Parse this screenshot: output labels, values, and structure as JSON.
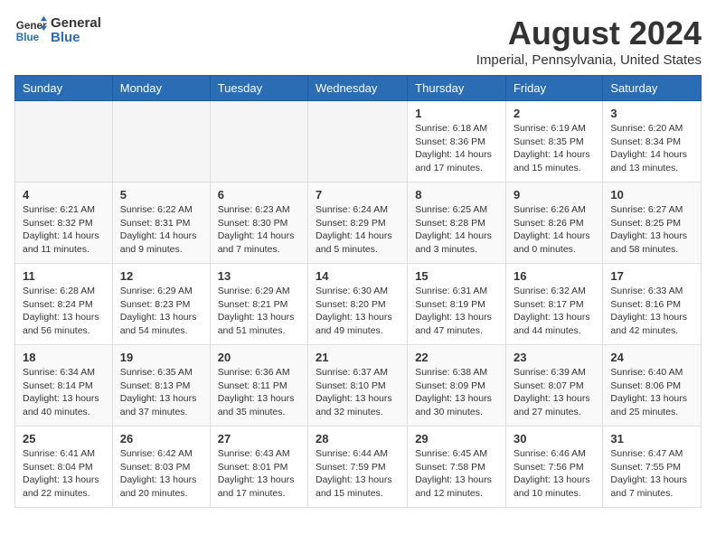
{
  "header": {
    "logo_line1": "General",
    "logo_line2": "Blue",
    "month": "August 2024",
    "location": "Imperial, Pennsylvania, United States"
  },
  "weekdays": [
    "Sunday",
    "Monday",
    "Tuesday",
    "Wednesday",
    "Thursday",
    "Friday",
    "Saturday"
  ],
  "weeks": [
    [
      {
        "day": "",
        "info": ""
      },
      {
        "day": "",
        "info": ""
      },
      {
        "day": "",
        "info": ""
      },
      {
        "day": "",
        "info": ""
      },
      {
        "day": "1",
        "info": "Sunrise: 6:18 AM\nSunset: 8:36 PM\nDaylight: 14 hours\nand 17 minutes."
      },
      {
        "day": "2",
        "info": "Sunrise: 6:19 AM\nSunset: 8:35 PM\nDaylight: 14 hours\nand 15 minutes."
      },
      {
        "day": "3",
        "info": "Sunrise: 6:20 AM\nSunset: 8:34 PM\nDaylight: 14 hours\nand 13 minutes."
      }
    ],
    [
      {
        "day": "4",
        "info": "Sunrise: 6:21 AM\nSunset: 8:32 PM\nDaylight: 14 hours\nand 11 minutes."
      },
      {
        "day": "5",
        "info": "Sunrise: 6:22 AM\nSunset: 8:31 PM\nDaylight: 14 hours\nand 9 minutes."
      },
      {
        "day": "6",
        "info": "Sunrise: 6:23 AM\nSunset: 8:30 PM\nDaylight: 14 hours\nand 7 minutes."
      },
      {
        "day": "7",
        "info": "Sunrise: 6:24 AM\nSunset: 8:29 PM\nDaylight: 14 hours\nand 5 minutes."
      },
      {
        "day": "8",
        "info": "Sunrise: 6:25 AM\nSunset: 8:28 PM\nDaylight: 14 hours\nand 3 minutes."
      },
      {
        "day": "9",
        "info": "Sunrise: 6:26 AM\nSunset: 8:26 PM\nDaylight: 14 hours\nand 0 minutes."
      },
      {
        "day": "10",
        "info": "Sunrise: 6:27 AM\nSunset: 8:25 PM\nDaylight: 13 hours\nand 58 minutes."
      }
    ],
    [
      {
        "day": "11",
        "info": "Sunrise: 6:28 AM\nSunset: 8:24 PM\nDaylight: 13 hours\nand 56 minutes."
      },
      {
        "day": "12",
        "info": "Sunrise: 6:29 AM\nSunset: 8:23 PM\nDaylight: 13 hours\nand 54 minutes."
      },
      {
        "day": "13",
        "info": "Sunrise: 6:29 AM\nSunset: 8:21 PM\nDaylight: 13 hours\nand 51 minutes."
      },
      {
        "day": "14",
        "info": "Sunrise: 6:30 AM\nSunset: 8:20 PM\nDaylight: 13 hours\nand 49 minutes."
      },
      {
        "day": "15",
        "info": "Sunrise: 6:31 AM\nSunset: 8:19 PM\nDaylight: 13 hours\nand 47 minutes."
      },
      {
        "day": "16",
        "info": "Sunrise: 6:32 AM\nSunset: 8:17 PM\nDaylight: 13 hours\nand 44 minutes."
      },
      {
        "day": "17",
        "info": "Sunrise: 6:33 AM\nSunset: 8:16 PM\nDaylight: 13 hours\nand 42 minutes."
      }
    ],
    [
      {
        "day": "18",
        "info": "Sunrise: 6:34 AM\nSunset: 8:14 PM\nDaylight: 13 hours\nand 40 minutes."
      },
      {
        "day": "19",
        "info": "Sunrise: 6:35 AM\nSunset: 8:13 PM\nDaylight: 13 hours\nand 37 minutes."
      },
      {
        "day": "20",
        "info": "Sunrise: 6:36 AM\nSunset: 8:11 PM\nDaylight: 13 hours\nand 35 minutes."
      },
      {
        "day": "21",
        "info": "Sunrise: 6:37 AM\nSunset: 8:10 PM\nDaylight: 13 hours\nand 32 minutes."
      },
      {
        "day": "22",
        "info": "Sunrise: 6:38 AM\nSunset: 8:09 PM\nDaylight: 13 hours\nand 30 minutes."
      },
      {
        "day": "23",
        "info": "Sunrise: 6:39 AM\nSunset: 8:07 PM\nDaylight: 13 hours\nand 27 minutes."
      },
      {
        "day": "24",
        "info": "Sunrise: 6:40 AM\nSunset: 8:06 PM\nDaylight: 13 hours\nand 25 minutes."
      }
    ],
    [
      {
        "day": "25",
        "info": "Sunrise: 6:41 AM\nSunset: 8:04 PM\nDaylight: 13 hours\nand 22 minutes."
      },
      {
        "day": "26",
        "info": "Sunrise: 6:42 AM\nSunset: 8:03 PM\nDaylight: 13 hours\nand 20 minutes."
      },
      {
        "day": "27",
        "info": "Sunrise: 6:43 AM\nSunset: 8:01 PM\nDaylight: 13 hours\nand 17 minutes."
      },
      {
        "day": "28",
        "info": "Sunrise: 6:44 AM\nSunset: 7:59 PM\nDaylight: 13 hours\nand 15 minutes."
      },
      {
        "day": "29",
        "info": "Sunrise: 6:45 AM\nSunset: 7:58 PM\nDaylight: 13 hours\nand 12 minutes."
      },
      {
        "day": "30",
        "info": "Sunrise: 6:46 AM\nSunset: 7:56 PM\nDaylight: 13 hours\nand 10 minutes."
      },
      {
        "day": "31",
        "info": "Sunrise: 6:47 AM\nSunset: 7:55 PM\nDaylight: 13 hours\nand 7 minutes."
      }
    ]
  ]
}
